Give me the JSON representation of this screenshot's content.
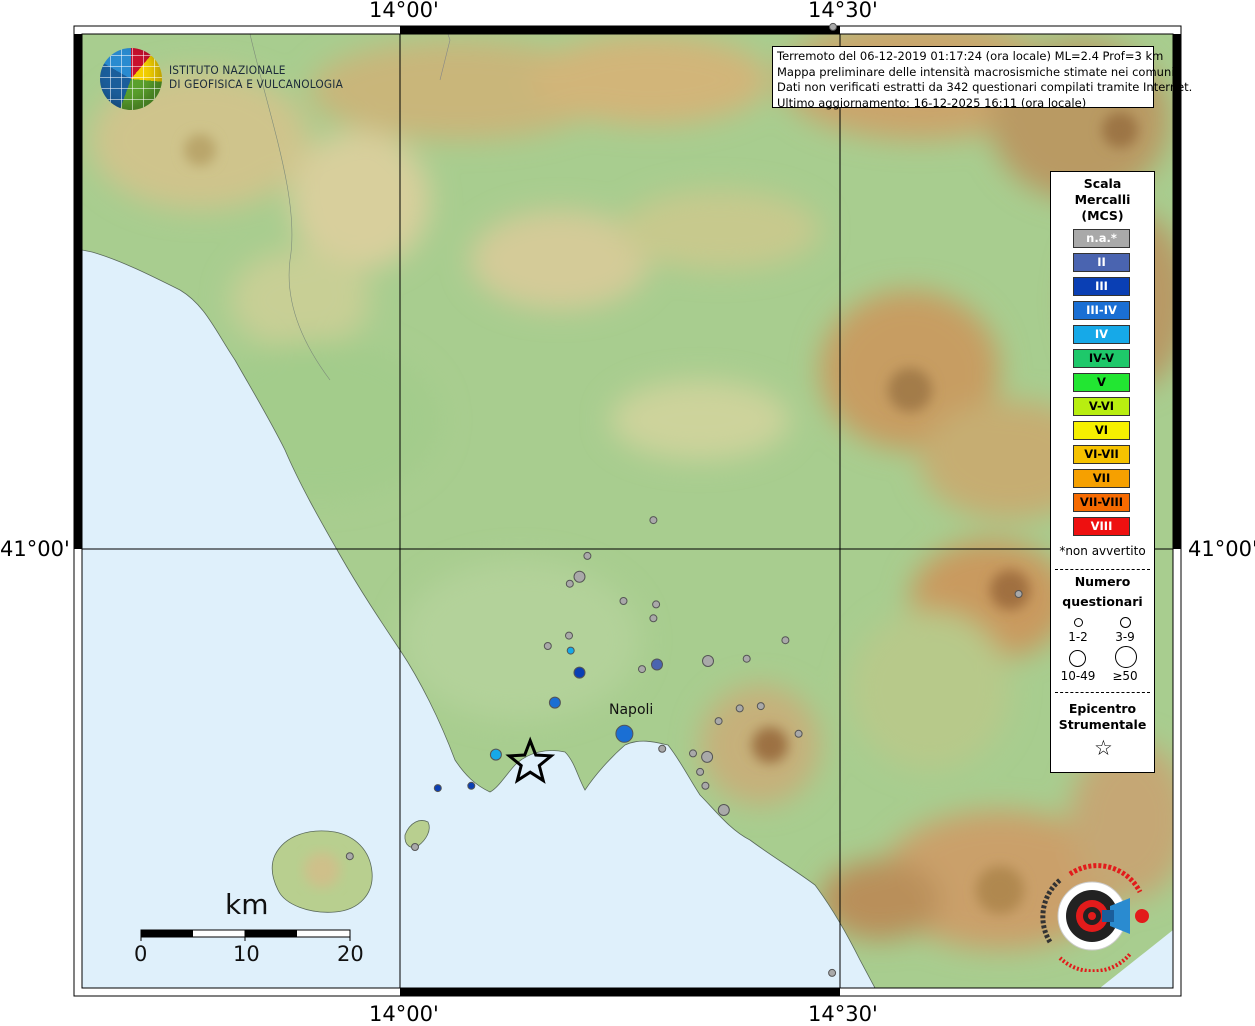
{
  "coordinates": {
    "top_left_lon": "14°00'",
    "top_right_lon": "14°30'",
    "bottom_left_lon": "14°00'",
    "bottom_right_lon": "14°30'",
    "left_lat": "41°00'",
    "right_lat": "41°00'"
  },
  "info": {
    "line1": "Terremoto del 06-12-2019 01:17:24 (ora locale) ML=2.4 Prof=3 km",
    "line2": "Mappa preliminare delle intensità macrosismiche stimate nei comuni",
    "line3": "Dati non verificati estratti da 342 questionari compilati tramite Internet.",
    "line4": "Ultimo aggiornamento: 16-12-2025 16:11 (ora locale)"
  },
  "institute": {
    "line1": "ISTITUTO NAZIONALE",
    "line2": "DI GEOFISICA E VULCANOLOGIA"
  },
  "legend": {
    "title1": "Scala",
    "title2": "Mercalli",
    "title3": "(MCS)",
    "classes": [
      {
        "label": "n.a.*",
        "color": "#a9a9a9",
        "text_color": "#ffffff"
      },
      {
        "label": "II",
        "color": "#4a64b0",
        "text_color": "#ffffff"
      },
      {
        "label": "III",
        "color": "#0a3fb4",
        "text_color": "#ffffff"
      },
      {
        "label": "III-IV",
        "color": "#1a6fd4",
        "text_color": "#ffffff"
      },
      {
        "label": "IV",
        "color": "#16a9e8",
        "text_color": "#ffffff"
      },
      {
        "label": "IV-V",
        "color": "#1ec86a",
        "text_color": "#000000"
      },
      {
        "label": "V",
        "color": "#22e632",
        "text_color": "#000000"
      },
      {
        "label": "V-VI",
        "color": "#b8ee10",
        "text_color": "#000000"
      },
      {
        "label": "VI",
        "color": "#f6f000",
        "text_color": "#000000"
      },
      {
        "label": "VI-VII",
        "color": "#f6c200",
        "text_color": "#000000"
      },
      {
        "label": "VII",
        "color": "#f6a000",
        "text_color": "#000000"
      },
      {
        "label": "VII-VIII",
        "color": "#f66a00",
        "text_color": "#000000"
      },
      {
        "label": "VIII",
        "color": "#ee1010",
        "text_color": "#ffffff"
      }
    ],
    "na_note": "*non avvertito",
    "count_title1": "Numero",
    "count_title2": "questionari",
    "count_labels": [
      "1-2",
      "3-9",
      "10-49",
      "≥50"
    ],
    "epicenter_title1": "Epicentro",
    "epicenter_title2": "Strumentale",
    "epicenter_symbol": "☆"
  },
  "scale_bar": {
    "unit": "km",
    "ticks": [
      "0",
      "10",
      "20"
    ]
  },
  "places": {
    "city": "Napoli"
  },
  "observations": [
    {
      "lon": 14.492,
      "lat": 41.452,
      "intensity": "n.a.*",
      "count": "1-2"
    },
    {
      "lon": 14.288,
      "lat": 41.025,
      "intensity": "n.a.*",
      "count": "1-2"
    },
    {
      "lon": 14.213,
      "lat": 40.994,
      "intensity": "n.a.*",
      "count": "1-2"
    },
    {
      "lon": 14.204,
      "lat": 40.976,
      "intensity": "n.a.*",
      "count": "3-9"
    },
    {
      "lon": 14.193,
      "lat": 40.97,
      "intensity": "n.a.*",
      "count": "1-2"
    },
    {
      "lon": 14.254,
      "lat": 40.955,
      "intensity": "n.a.*",
      "count": "1-2"
    },
    {
      "lon": 14.291,
      "lat": 40.952,
      "intensity": "n.a.*",
      "count": "1-2"
    },
    {
      "lon": 14.288,
      "lat": 40.94,
      "intensity": "n.a.*",
      "count": "1-2"
    },
    {
      "lon": 14.703,
      "lat": 40.961,
      "intensity": "n.a.*",
      "count": "1-2"
    },
    {
      "lon": 14.192,
      "lat": 40.925,
      "intensity": "n.a.*",
      "count": "1-2"
    },
    {
      "lon": 14.168,
      "lat": 40.916,
      "intensity": "n.a.*",
      "count": "1-2"
    },
    {
      "lon": 14.194,
      "lat": 40.912,
      "intensity": "IV",
      "count": "1-2"
    },
    {
      "lon": 14.275,
      "lat": 40.896,
      "intensity": "n.a.*",
      "count": "1-2"
    },
    {
      "lon": 14.292,
      "lat": 40.9,
      "intensity": "II",
      "count": "3-9"
    },
    {
      "lon": 14.204,
      "lat": 40.893,
      "intensity": "III",
      "count": "3-9"
    },
    {
      "lon": 14.35,
      "lat": 40.903,
      "intensity": "n.a.*",
      "count": "3-9"
    },
    {
      "lon": 14.394,
      "lat": 40.905,
      "intensity": "n.a.*",
      "count": "1-2"
    },
    {
      "lon": 14.438,
      "lat": 40.921,
      "intensity": "n.a.*",
      "count": "1-2"
    },
    {
      "lon": 14.176,
      "lat": 40.867,
      "intensity": "III-IV",
      "count": "3-9"
    },
    {
      "lon": 14.386,
      "lat": 40.862,
      "intensity": "n.a.*",
      "count": "1-2"
    },
    {
      "lon": 14.41,
      "lat": 40.864,
      "intensity": "n.a.*",
      "count": "1-2"
    },
    {
      "lon": 14.362,
      "lat": 40.851,
      "intensity": "n.a.*",
      "count": "1-2"
    },
    {
      "lon": 14.255,
      "lat": 40.84,
      "intensity": "III-IV",
      "count": "10-49"
    },
    {
      "lon": 14.453,
      "lat": 40.84,
      "intensity": "n.a.*",
      "count": "1-2"
    },
    {
      "lon": 14.333,
      "lat": 40.823,
      "intensity": "n.a.*",
      "count": "1-2"
    },
    {
      "lon": 14.298,
      "lat": 40.827,
      "intensity": "n.a.*",
      "count": "1-2"
    },
    {
      "lon": 14.349,
      "lat": 40.82,
      "intensity": "n.a.*",
      "count": "3-9"
    },
    {
      "lon": 14.109,
      "lat": 40.822,
      "intensity": "IV",
      "count": "3-9"
    },
    {
      "lon": 14.341,
      "lat": 40.807,
      "intensity": "n.a.*",
      "count": "1-2"
    },
    {
      "lon": 14.347,
      "lat": 40.795,
      "intensity": "n.a.*",
      "count": "1-2"
    },
    {
      "lon": 14.081,
      "lat": 40.795,
      "intensity": "III",
      "count": "1-2"
    },
    {
      "lon": 14.043,
      "lat": 40.793,
      "intensity": "III",
      "count": "1-2"
    },
    {
      "lon": 14.368,
      "lat": 40.774,
      "intensity": "n.a.*",
      "count": "3-9"
    },
    {
      "lon": 14.017,
      "lat": 40.742,
      "intensity": "n.a.*",
      "count": "1-2"
    },
    {
      "lon": 13.943,
      "lat": 40.734,
      "intensity": "n.a.*",
      "count": "1-2"
    },
    {
      "lon": 14.491,
      "lat": 40.633,
      "intensity": "n.a.*",
      "count": "1-2"
    }
  ],
  "epicenter": {
    "lon": 14.148,
    "lat": 40.815
  }
}
